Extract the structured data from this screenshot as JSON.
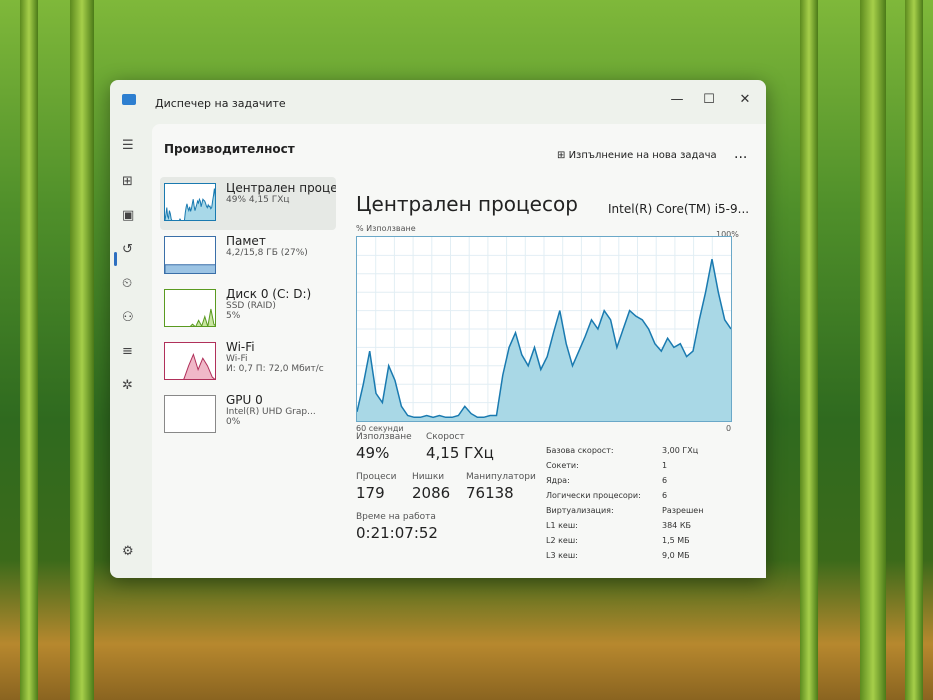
{
  "window": {
    "title": "Диспечер на задачите",
    "minimize": "—",
    "maximize": "☐",
    "close": "✕"
  },
  "nav_icons": [
    "hamburger-icon",
    "processes-icon",
    "performance-icon",
    "app-history-icon",
    "startup-icon",
    "users-icon",
    "details-icon",
    "services-icon",
    "settings-icon"
  ],
  "header": {
    "title": "Производителност",
    "new_task": "Изпълнение на нова задача",
    "more": "..."
  },
  "sidebar": [
    {
      "name": "Централен проце",
      "sub1": "49% 4,15 ГХц",
      "sub2": "",
      "color": "#1a7ab0",
      "fill": "#a8d8e8"
    },
    {
      "name": "Памет",
      "sub1": "4,2/15,8 ГБ (27%)",
      "sub2": "",
      "color": "#3a6fa8",
      "fill": "#9cc4e4"
    },
    {
      "name": "Диск 0 (C: D:)",
      "sub1": "SSD (RAID)",
      "sub2": "5%",
      "color": "#5a9a20",
      "fill": "#c8e6a0"
    },
    {
      "name": "Wi-Fi",
      "sub1": "Wi-Fi",
      "sub2": "И: 0,7 П: 72,0 Мбит/с",
      "color": "#b0305a",
      "fill": "#f0b8c8"
    },
    {
      "name": "GPU 0",
      "sub1": "Intel(R) UHD Grap...",
      "sub2": "0%",
      "color": "#888",
      "fill": "#fff"
    }
  ],
  "cpu": {
    "title": "Централен процесор",
    "model": "Intel(R) Core(TM) i5-9...",
    "graph_label": "% Използване",
    "max_label": "100%",
    "time_label": "60 секунди",
    "min_label": "0",
    "usage_values": [
      5,
      20,
      38,
      15,
      10,
      30,
      22,
      8,
      3,
      2,
      2,
      3,
      2,
      3,
      2,
      2,
      3,
      8,
      4,
      2,
      2,
      3,
      3,
      25,
      40,
      48,
      36,
      30,
      40,
      28,
      35,
      48,
      60,
      42,
      30,
      38,
      46,
      55,
      50,
      60,
      55,
      40,
      50,
      60,
      57,
      55,
      50,
      42,
      38,
      45,
      40,
      42,
      35,
      38,
      55,
      70,
      88,
      70,
      55,
      50
    ],
    "stats": [
      {
        "label": "Използване",
        "value": "49%"
      },
      {
        "label": "Скорост",
        "value": "4,15 ГХц"
      },
      {
        "label": "Процеси",
        "value": "179"
      },
      {
        "label": "Нишки",
        "value": "2086"
      },
      {
        "label": "Манипулатори",
        "value": "76138"
      },
      {
        "label": "Време на работа",
        "value": "0:21:07:52"
      }
    ],
    "specs": [
      {
        "k": "Базова скорост:",
        "v": "3,00 ГХц"
      },
      {
        "k": "Сокети:",
        "v": "1"
      },
      {
        "k": "Ядра:",
        "v": "6"
      },
      {
        "k": "Логически процесори:",
        "v": "6"
      },
      {
        "k": "Виртуализация:",
        "v": "Разрешен"
      },
      {
        "k": "L1 кеш:",
        "v": "384 КБ"
      },
      {
        "k": "L2 кеш:",
        "v": "1,5 МБ"
      },
      {
        "k": "L3 кеш:",
        "v": "9,0 МБ"
      }
    ]
  }
}
